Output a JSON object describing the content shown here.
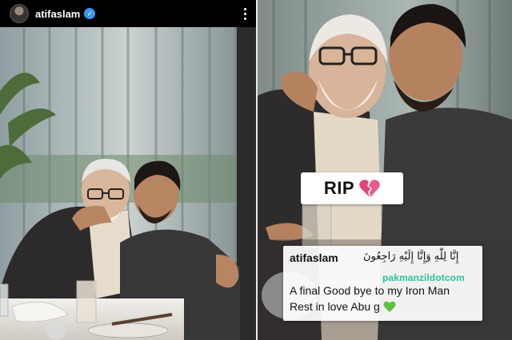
{
  "header": {
    "username": "atifaslam",
    "verified_icon": "verified-badge-icon",
    "more_icon": "more-options-icon"
  },
  "sticker": {
    "text": "RIP",
    "icon": "broken-heart-icon"
  },
  "caption": {
    "username": "atifaslam",
    "arabic_text": "إِنَّا لِلّٰهِ وَإِنَّا إِلَيْهِ رَاجِعُونَ",
    "watermark": "pakmanzildotcom",
    "line1": "A final Good bye to my Iron Man",
    "line2": "Rest in love Abu g",
    "line2_icon": "green-heart-icon"
  },
  "colors": {
    "verified_blue": "#3897f0",
    "watermark_green": "#2fbfa0",
    "broken_heart": "#e0457b",
    "green_heart": "#5dc23a"
  }
}
